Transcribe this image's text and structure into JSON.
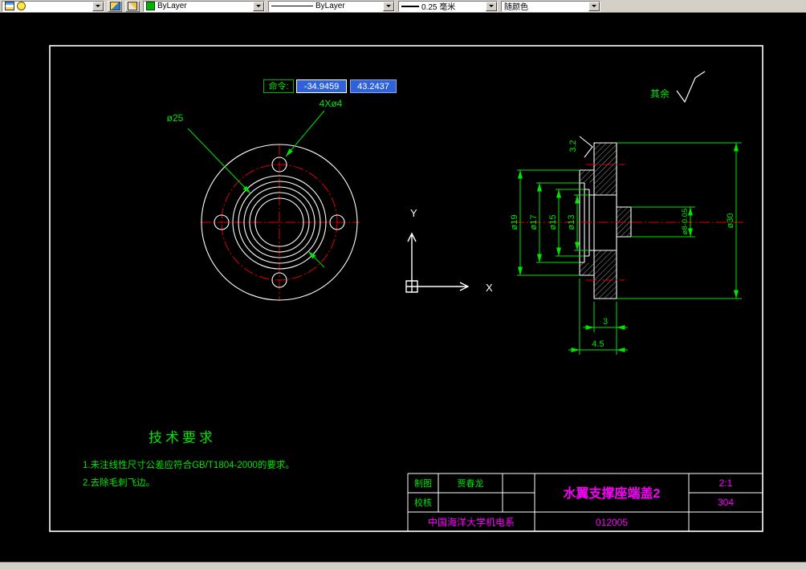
{
  "toolbar": {
    "color_value": "ByLayer",
    "linetype_value": "ByLayer",
    "lineweight_value": "0.25 毫米",
    "plot_style_value": "随颜色"
  },
  "dynamic_input": {
    "command_label": "命令:",
    "x_coord": "-34.9459",
    "y_coord": "43.2437"
  },
  "ucs": {
    "x_label": "X",
    "y_label": "Y"
  },
  "front_view": {
    "boss_dim": "ø25",
    "holes_dim": "4Xø4"
  },
  "section_view": {
    "dia_19": "ø19",
    "dia_17": "ø17",
    "dia_15": "ø15",
    "dia_13": "ø13",
    "dia_8": "ø8-0.05",
    "dia_30": "ø30",
    "thickness": "3",
    "total_width": "4.5",
    "roughness": "3.2"
  },
  "surface_note": {
    "label": "其余"
  },
  "tech": {
    "title": "技术要求",
    "line1": "1.未注线性尺寸公差应符合GB/T1804-2000的要求。",
    "line2": "2.去除毛刺飞边。"
  },
  "title_block": {
    "drawn_label": "制图",
    "drawn_by": "贾春龙",
    "checked_label": "校核",
    "part_name": "水翼支撑座端盖2",
    "scale": "2:1",
    "material": "304",
    "organization": "中国海洋大学机电系",
    "drawing_no": "012005"
  },
  "colors": {
    "dimension_green": "#00e500",
    "centerline_red": "#e00000",
    "object_white": "#ffffff",
    "annotation_magenta": "#ff00ff",
    "layer_color_swatch": "#00b400",
    "input_blue": "#2f62d8"
  }
}
